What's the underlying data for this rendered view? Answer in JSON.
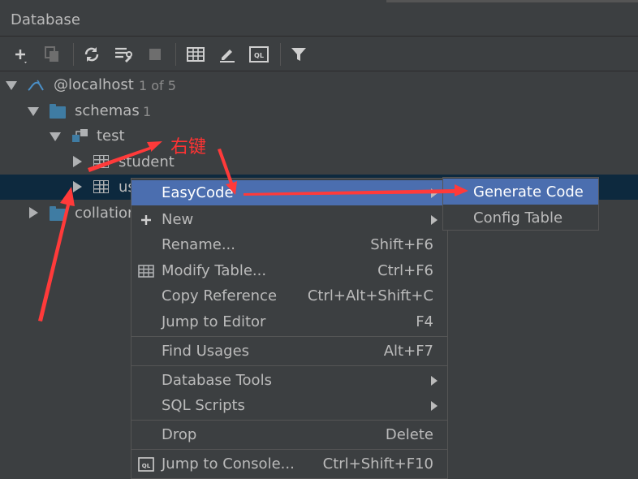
{
  "panel": {
    "title": "Database"
  },
  "toolbar": {
    "buttons": [
      "add-icon",
      "copy-icon",
      "refresh-icon",
      "settings-icon",
      "stop-icon",
      "table-icon",
      "edit-icon",
      "ql-console-icon",
      "filter-icon"
    ]
  },
  "tree": {
    "host": {
      "label": "@localhost",
      "count": "1 of 5"
    },
    "schemas": {
      "label": "schemas",
      "count": "1"
    },
    "test": {
      "label": "test"
    },
    "student": {
      "label": "student"
    },
    "user": {
      "label": "us"
    },
    "collations": {
      "label": "collation"
    }
  },
  "annotation": {
    "text": "右键"
  },
  "context_menu": {
    "easycode": "EasyCode",
    "new": "New",
    "rename": {
      "label": "Rename...",
      "shortcut": "Shift+F6"
    },
    "modify_table": {
      "label": "Modify Table...",
      "shortcut": "Ctrl+F6"
    },
    "copy_reference": {
      "label": "Copy Reference",
      "shortcut": "Ctrl+Alt+Shift+C"
    },
    "jump_editor": {
      "label": "Jump to Editor",
      "shortcut": "F4"
    },
    "find_usages": {
      "label": "Find Usages",
      "shortcut": "Alt+F7"
    },
    "database_tools": "Database Tools",
    "sql_scripts": "SQL Scripts",
    "drop": {
      "label": "Drop",
      "shortcut": "Delete"
    },
    "jump_console": {
      "label": "Jump to Console...",
      "shortcut": "Ctrl+Shift+F10"
    }
  },
  "submenu": {
    "generate_code": "Generate Code",
    "config_table": "Config Table"
  },
  "colors": {
    "background": "#3c3f41",
    "selection": "#0d293e",
    "highlight": "#4b6eaf",
    "annotation": "#ff3333",
    "folder": "#3f7ca3"
  }
}
